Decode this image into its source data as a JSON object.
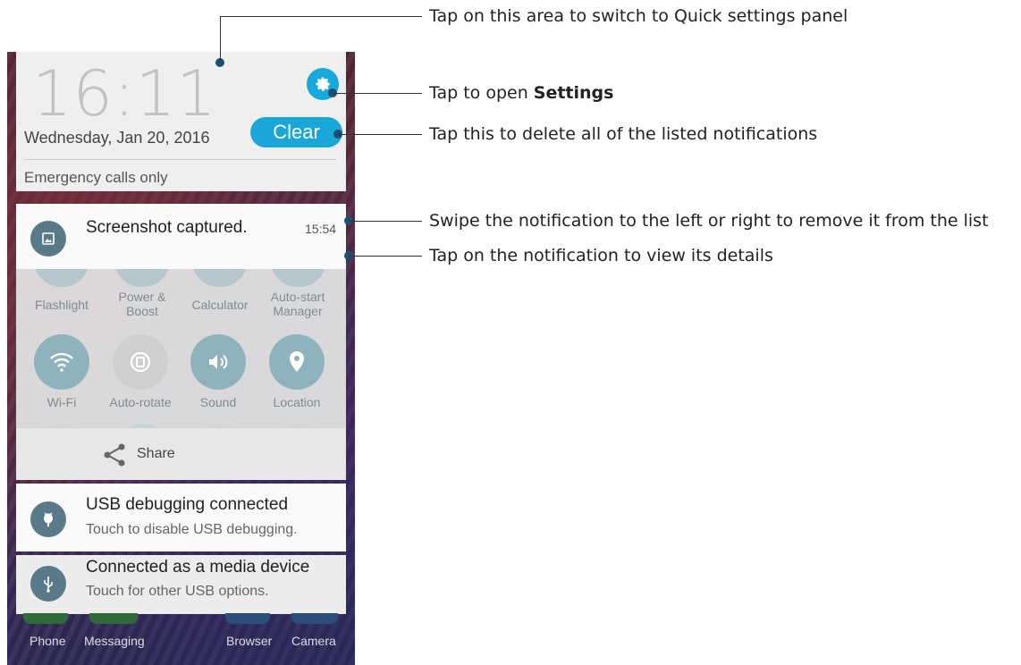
{
  "status": {
    "time": "16:11",
    "date": "Wednesday, Jan 20, 2016",
    "clear_label": "Clear",
    "carrier": "Emergency calls only"
  },
  "notifications": [
    {
      "title": "Screenshot captured.",
      "time": "15:54",
      "icon": "image-icon"
    },
    {
      "title": "USB debugging connected",
      "subtitle": "Touch to disable USB debugging.",
      "icon": "android-debug-icon"
    },
    {
      "title": "Connected as a media device",
      "subtitle": "Touch for other USB options.",
      "icon": "usb-icon"
    }
  ],
  "quick_settings": {
    "top_labels": [
      "Flashlight",
      "Power & Boost",
      "Calculator",
      "Auto-start Manager"
    ],
    "tiles": [
      {
        "label": "Wi-Fi",
        "icon": "wifi-icon",
        "state": "on"
      },
      {
        "label": "Auto-rotate",
        "icon": "auto-rotate-icon",
        "state": "off"
      },
      {
        "label": "Sound",
        "icon": "sound-icon",
        "state": "on"
      },
      {
        "label": "Location",
        "icon": "location-icon",
        "state": "on"
      }
    ],
    "bottom_icons": [
      "airplane-icon",
      "globe-icon",
      "nfc-icon",
      "bluetooth-icon"
    ]
  },
  "share": {
    "label": "Share",
    "icon": "share-icon"
  },
  "dock": [
    "Phone",
    "Messaging",
    "Browser",
    "Camera"
  ],
  "callouts": {
    "quick_settings": "Tap on this area to switch to Quick settings panel",
    "settings_prefix": "Tap to open ",
    "settings_bold": "Settings",
    "clear": "Tap this to delete all of the listed notifications",
    "swipe": "Swipe the notification to the left or right to remove it from the list",
    "tap_notification": "Tap on the notification to view its details"
  },
  "colors": {
    "accent": "#1aa6d6",
    "dot": "#1c4f74",
    "tile_on": "#8fb3bd",
    "icon_bg": "#5a7a8a"
  }
}
